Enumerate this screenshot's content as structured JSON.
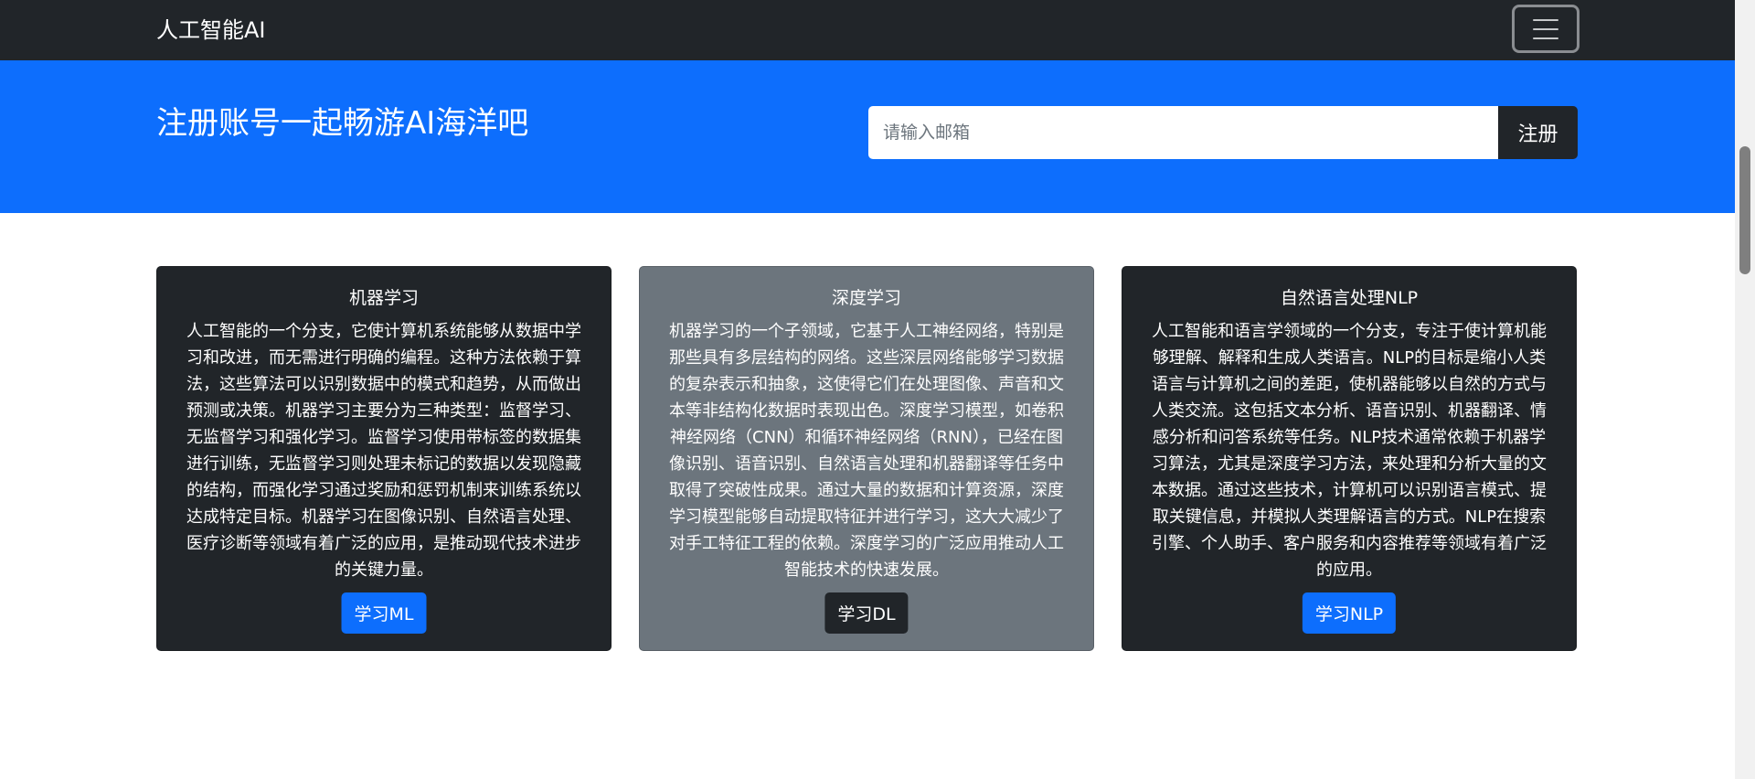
{
  "navbar": {
    "brand": "人工智能AI",
    "menu_icon": "hamburger-menu-icon"
  },
  "hero": {
    "title": "注册账号一起畅游AI海洋吧",
    "email_placeholder": "请输入邮箱",
    "register_label": "注册"
  },
  "cards": [
    {
      "title": "机器学习",
      "text": "人工智能的一个分支，它使计算机系统能够从数据中学习和改进，而无需进行明确的编程。这种方法依赖于算法，这些算法可以识别数据中的模式和趋势，从而做出预测或决策。机器学习主要分为三种类型：监督学习、无监督学习和强化学习。监督学习使用带标签的数据集进行训练，无监督学习则处理未标记的数据以发现隐藏的结构，而强化学习通过奖励和惩罚机制来训练系统以达成特定目标。机器学习在图像识别、自然语言处理、医疗诊断等领域有着广泛的应用，是推动现代技术进步的关键力量。",
      "button": "学习ML"
    },
    {
      "title": "深度学习",
      "text": "机器学习的一个子领域，它基于人工神经网络，特别是那些具有多层结构的网络。这些深层网络能够学习数据的复杂表示和抽象，这使得它们在处理图像、声音和文本等非结构化数据时表现出色。深度学习模型，如卷积神经网络（CNN）和循环神经网络（RNN），已经在图像识别、语音识别、自然语言处理和机器翻译等任务中取得了突破性成果。通过大量的数据和计算资源，深度学习模型能够自动提取特征并进行学习，这大大减少了对手工特征工程的依赖。深度学习的广泛应用推动人工智能技术的快速发展。",
      "button": "学习DL"
    },
    {
      "title": "自然语言处理NLP",
      "text": "人工智能和语言学领域的一个分支，专注于使计算机能够理解、解释和生成人类语言。NLP的目标是缩小人类语言与计算机之间的差距，使机器能够以自然的方式与人类交流。这包括文本分析、语音识别、机器翻译、情感分析和问答系统等任务。NLP技术通常依赖于机器学习算法，尤其是深度学习方法，来处理和分析大量的文本数据。通过这些技术，计算机可以识别语言模式、提取关键信息，并模拟人类理解语言的方式。NLP在搜索引擎、个人助手、客户服务和内容推荐等领域有着广泛的应用。",
      "button": "学习NLP"
    }
  ],
  "colors": {
    "navbar_bg": "#212529",
    "hero_bg": "#0d6efd",
    "card_dark": "#212529",
    "card_gray": "#6c757d",
    "primary_button": "#0d6efd"
  }
}
